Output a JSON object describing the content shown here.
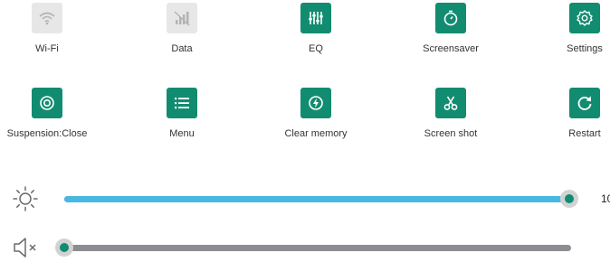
{
  "tiles_row1": [
    {
      "label": "Wi-Fi",
      "icon": "wifi-icon",
      "state": "off"
    },
    {
      "label": "Data",
      "icon": "mobile-data-icon",
      "state": "off"
    },
    {
      "label": "EQ",
      "icon": "equalizer-icon",
      "state": "on"
    },
    {
      "label": "Screensaver",
      "icon": "timer-icon",
      "state": "on"
    },
    {
      "label": "Settings",
      "icon": "gear-icon",
      "state": "on"
    }
  ],
  "tiles_row2": [
    {
      "label": "Suspension:Close",
      "icon": "target-icon",
      "state": "on"
    },
    {
      "label": "Menu",
      "icon": "menu-list-icon",
      "state": "on"
    },
    {
      "label": "Clear memory",
      "icon": "clear-memory-icon",
      "state": "on"
    },
    {
      "label": "Screen shot",
      "icon": "scissors-icon",
      "state": "on"
    },
    {
      "label": "Restart",
      "icon": "restart-icon",
      "state": "on"
    }
  ],
  "brightness": {
    "icon": "brightness-icon",
    "level_percent": 100,
    "value_text": "10"
  },
  "volume": {
    "icon": "volume-muted-icon",
    "level_percent": 0
  },
  "colors": {
    "accent": "#128c70",
    "inactive": "#e7e7e7",
    "slider_fill": "#49b8e0",
    "slider_track": "#8c8d90"
  }
}
